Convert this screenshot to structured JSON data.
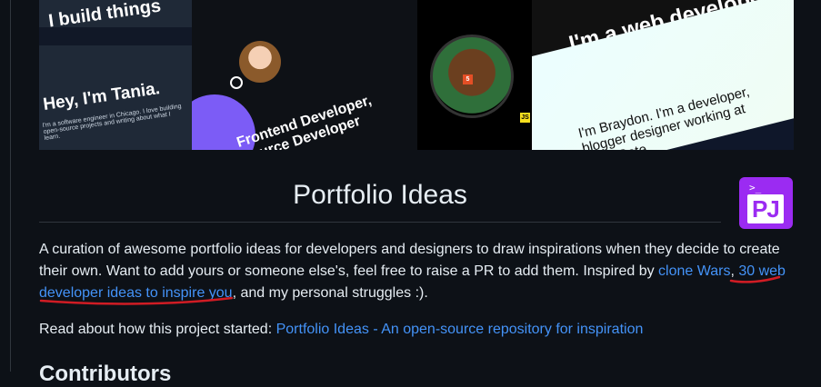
{
  "banner": {
    "tania_greeting": "Hey, I'm Tania.",
    "tania_intro": "I'm a software engineer in Chicago. I love building open-source projects and writing about what I learn.",
    "tania_headline": "I build things",
    "victor_headline": "Frontend Developer, Source Developer",
    "webdev_headline": "I'm a web developer",
    "braydon_line": "I'm Braydon. I'm a developer, blogger designer working at LogicGate.",
    "badges": [
      "5",
      "3",
      "JS"
    ]
  },
  "logo": {
    "prompt": ">_",
    "letters": "PJ"
  },
  "heading": {
    "title": "Portfolio Ideas"
  },
  "intro": {
    "text_before": "A curation of awesome portfolio ideas for developers and designers to draw inspirations when they decide to create their own. Want to add yours or someone else's, feel free to raise a PR to add them. Inspired by ",
    "link_clone_wars": "clone Wars",
    "sep": ", ",
    "link_30_web": "30 web developer ideas to inspire you",
    "text_after": ", and my personal struggles :)."
  },
  "read": {
    "prefix": "Read about how this project started: ",
    "link": "Portfolio Ideas - An open-source repository for inspiration"
  },
  "next_section": {
    "title": "Contributors"
  },
  "colors": {
    "link": "#4493f8",
    "background": "#0d1117",
    "annotation": "#d01c24",
    "logo": "#9b2bf2"
  }
}
